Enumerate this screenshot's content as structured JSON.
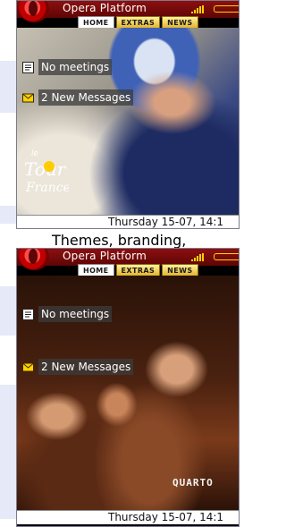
{
  "caption": "Themes, branding,",
  "panels": [
    {
      "app_title": "Opera Platform",
      "tabs": [
        "HOME",
        "EXTRAS",
        "NEWS"
      ],
      "meetings": "No meetings",
      "messages": "2 New Messages",
      "status_bar": "Thursday 15-07, 14:1",
      "brand_logo": "le Tour de France"
    },
    {
      "app_title": "Opera Platform",
      "tabs": [
        "HOME",
        "EXTRAS",
        "NEWS"
      ],
      "meetings": "No meetings",
      "messages": "2 New Messages",
      "status_bar": "Thursday 15-07, 14:1",
      "brand_logo": "QUARTO"
    }
  ],
  "colors": {
    "titlebar": "#7a0a0a",
    "tab_gold": "#e2b52c",
    "signal": "#ffd200"
  }
}
